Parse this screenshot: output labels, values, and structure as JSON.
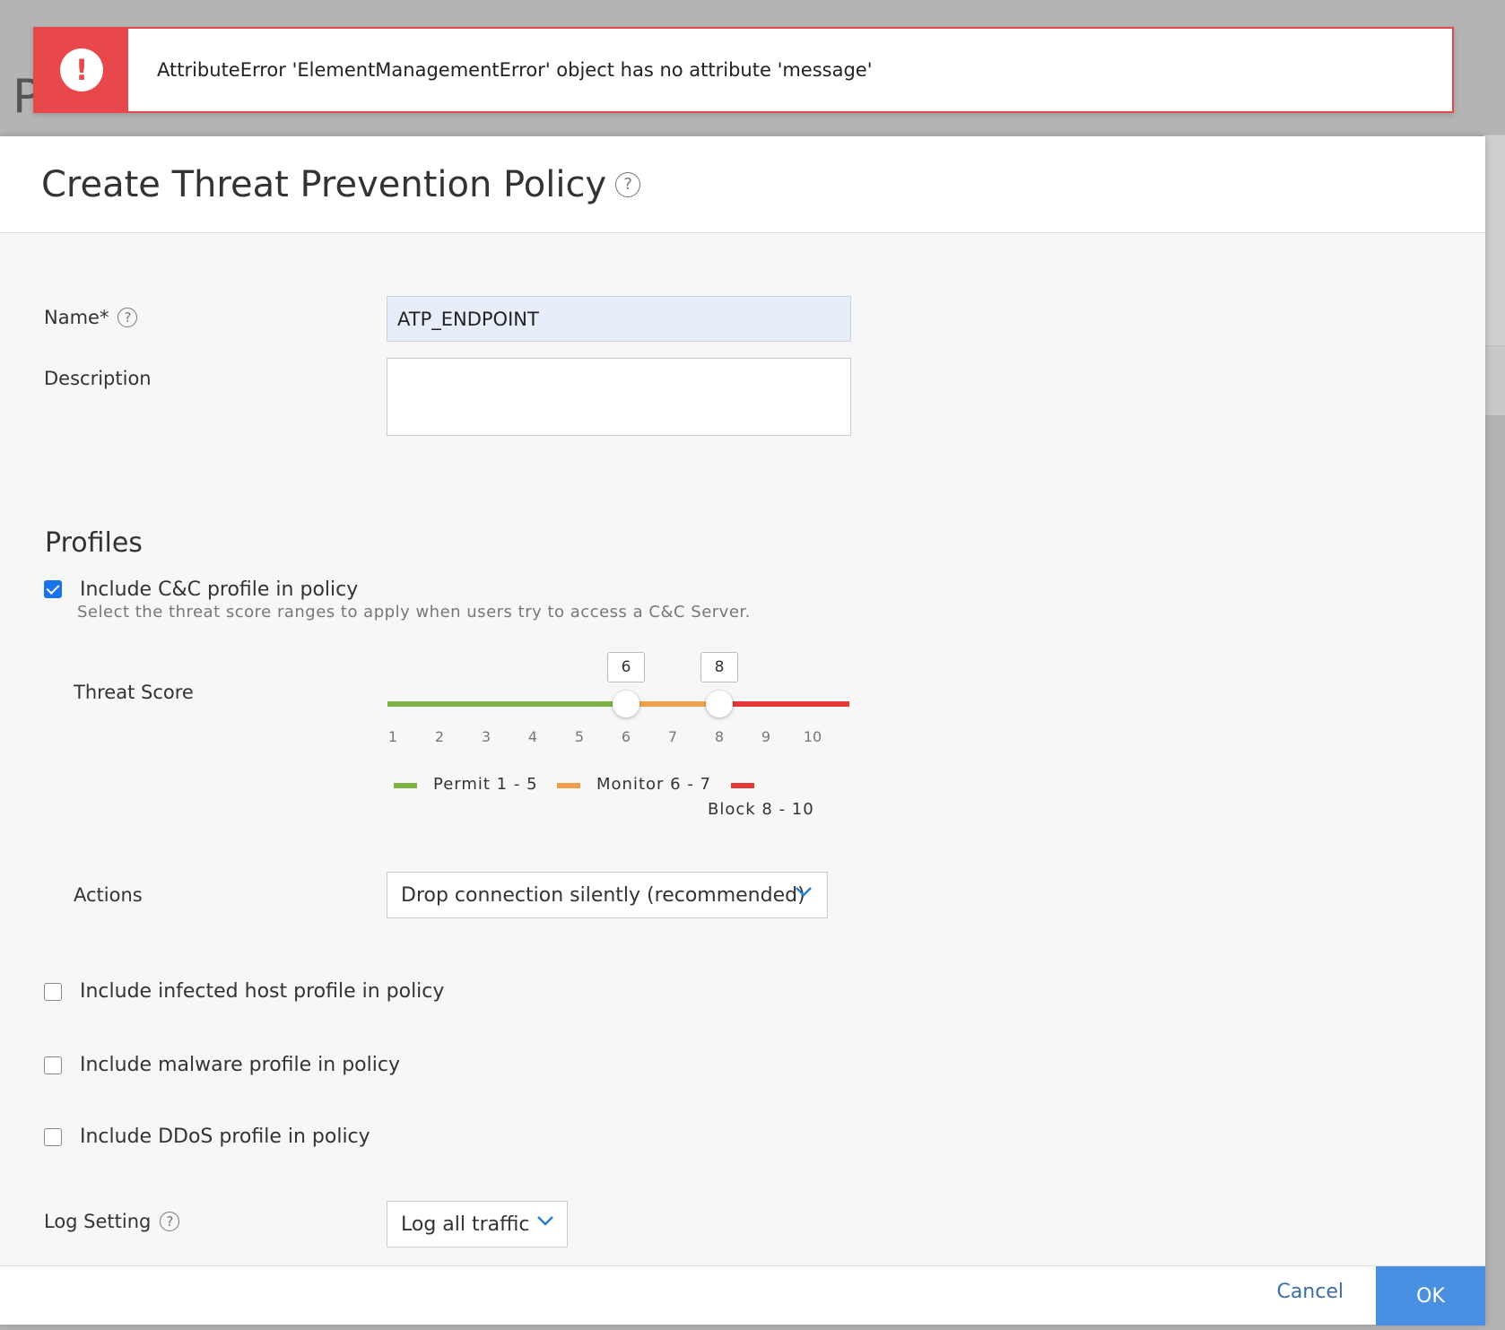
{
  "background": {
    "page_title": "Policies"
  },
  "error": {
    "message": "AttributeError 'ElementManagementError' object has no attribute 'message'",
    "color": "#e8474c"
  },
  "modal": {
    "title": "Create Threat Prevention Policy",
    "name_label": "Name*",
    "name_value": "ATP_ENDPOINT",
    "description_label": "Description",
    "description_value": "",
    "profiles_title": "Profiles",
    "cc_profile": {
      "label": "Include C&C profile in policy",
      "checked": true,
      "subtitle": "Select the threat score ranges to apply when users try to access a C&C Server."
    },
    "threat_score": {
      "label": "Threat Score",
      "min": 1,
      "max": 10,
      "handle_low": "6",
      "handle_high": "8",
      "ticks": [
        "1",
        "2",
        "3",
        "4",
        "5",
        "6",
        "7",
        "8",
        "9",
        "10"
      ],
      "legend": [
        {
          "label": "Permit 1 - 5",
          "color": "#7cb342"
        },
        {
          "label": "Monitor 6 - 7",
          "color": "#f0a04b"
        },
        {
          "label": "Block 8 - 10",
          "color": "#e53935"
        }
      ]
    },
    "actions_label": "Actions",
    "actions_value": "Drop connection silently (recommended)",
    "infected_host_label": "Include infected host profile in policy",
    "malware_label": "Include malware profile in policy",
    "ddos_label": "Include DDoS profile in policy",
    "log_setting_label": "Log Setting",
    "log_setting_value": "Log all traffic",
    "cancel_label": "Cancel",
    "ok_label": "OK"
  }
}
